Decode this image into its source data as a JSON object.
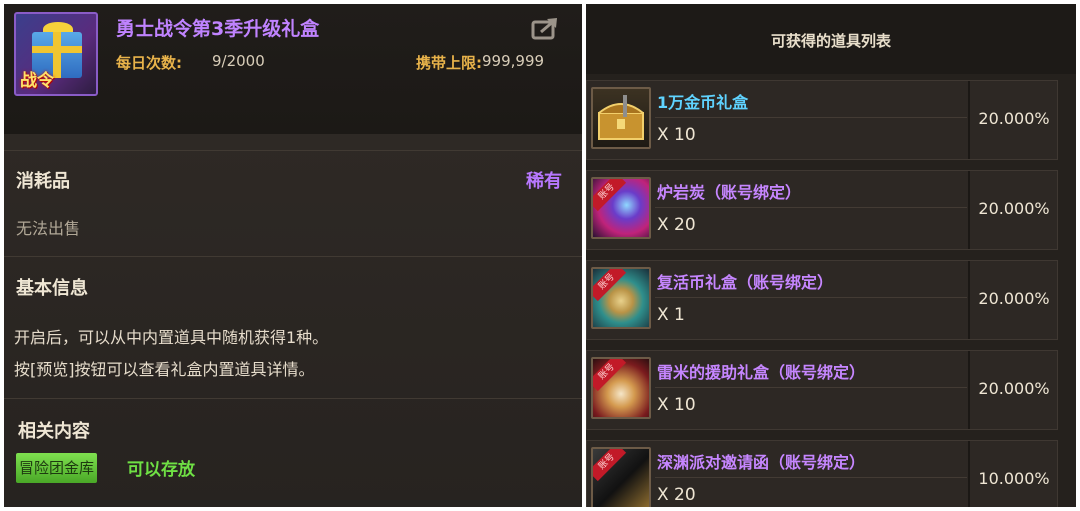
{
  "item": {
    "title": "勇士战令第3季升级礼盒",
    "icon_tag": "战令",
    "icon": "gift-box-icon",
    "daily_label": "每日次数:",
    "daily_value": "9/2000",
    "cap_label": "携带上限:",
    "cap_value": "999,999"
  },
  "details": {
    "category": "消耗品",
    "rarity": "稀有",
    "sell_status": "无法出售",
    "basic_info_heading": "基本信息",
    "description_lines": [
      "开启后，可以从中内置道具中随机获得1种。",
      "按[预览]按钮可以查看礼盒内置道具详情。"
    ],
    "related_heading": "相关内容",
    "vault_badge": "冒险团金库",
    "vault_status": "可以存放"
  },
  "colors": {
    "title_purple": "#c083ff",
    "rarity_purple": "#b878ff",
    "label_gold": "#e8b34a",
    "name_cyan": "#5fd3ff",
    "name_purple": "#c686ff",
    "badge_green": "#6fe044"
  },
  "reward_list": {
    "title": "可获得的道具列表",
    "items": [
      {
        "name": "1万金币礼盒",
        "quantity": "X 10",
        "probability": "20.000%",
        "name_color": "#5fd3ff",
        "icon": "gold-chest-icon",
        "account_tag": ""
      },
      {
        "name": "炉岩炭（账号绑定）",
        "quantity": "X 20",
        "probability": "20.000%",
        "name_color": "#c686ff",
        "icon": "orb-icon",
        "account_tag": "账号"
      },
      {
        "name": "复活币礼盒（账号绑定）",
        "quantity": "X 1",
        "probability": "20.000%",
        "name_color": "#c686ff",
        "icon": "coin-icon",
        "account_tag": "账号"
      },
      {
        "name": "雷米的援助礼盒（账号绑定）",
        "quantity": "X 10",
        "probability": "20.000%",
        "name_color": "#c686ff",
        "icon": "glove-icon",
        "account_tag": "账号"
      },
      {
        "name": "深渊派对邀请函（账号绑定）",
        "quantity": "X 20",
        "probability": "10.000%",
        "name_color": "#c686ff",
        "icon": "invitation-icon",
        "account_tag": "账号"
      }
    ]
  }
}
